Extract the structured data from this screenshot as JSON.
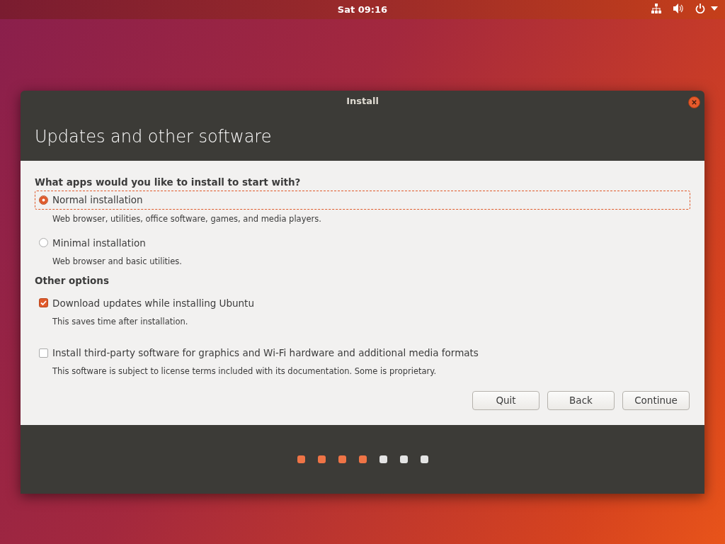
{
  "top_bar": {
    "clock": "Sat 09:16"
  },
  "window": {
    "title": "Install"
  },
  "header": {
    "title": "Updates and other software"
  },
  "install_type": {
    "question": "What apps would you like to install to start with?",
    "options": [
      {
        "label": "Normal installation",
        "description": "Web browser, utilities, office software, games, and media players.",
        "selected": true,
        "focused": true
      },
      {
        "label": "Minimal installation",
        "description": "Web browser and basic utilities.",
        "selected": false,
        "focused": false
      }
    ]
  },
  "other_options": {
    "heading": "Other options",
    "items": [
      {
        "label": "Download updates while installing Ubuntu",
        "description": "This saves time after installation.",
        "checked": true
      },
      {
        "label": "Install third-party software for graphics and Wi-Fi hardware and additional media formats",
        "description": "This software is subject to license terms included with its documentation. Some is proprietary.",
        "checked": false
      }
    ]
  },
  "buttons": [
    "Quit",
    "Back",
    "Continue"
  ],
  "progress_steps": [
    {
      "done": true
    },
    {
      "done": true
    },
    {
      "done": true
    },
    {
      "done": true
    },
    {
      "done": false
    },
    {
      "done": false
    },
    {
      "done": false
    }
  ]
}
